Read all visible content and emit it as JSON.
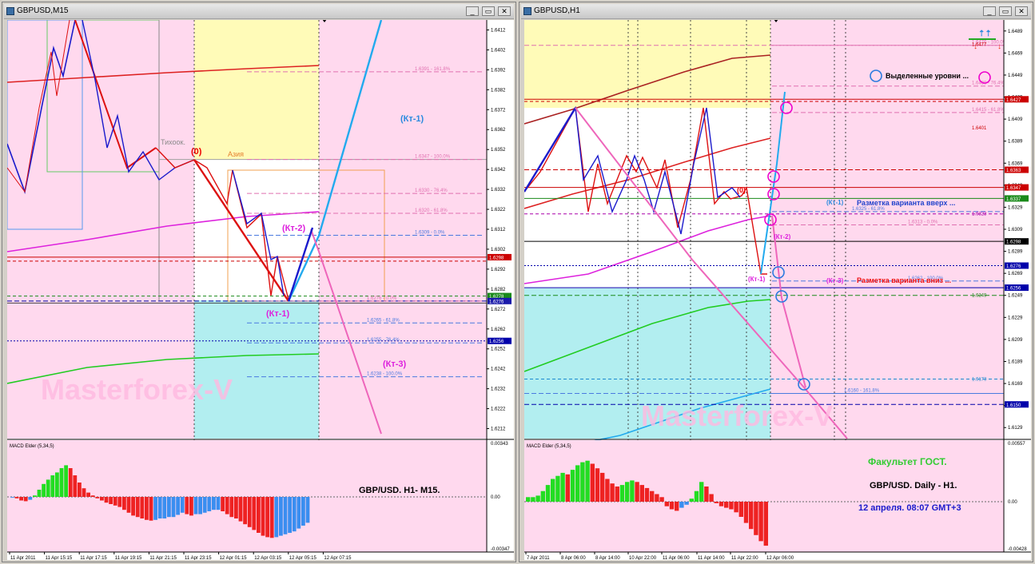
{
  "left": {
    "title": "GBPUSD,M15",
    "buttons": {
      "minimize": "_",
      "restore": "▭",
      "close": "✕"
    },
    "price_ticks": [
      "1.6412",
      "1.6402",
      "1.6392",
      "1.6382",
      "1.6372",
      "1.6362",
      "1.6352",
      "1.6342",
      "1.6332",
      "1.6322",
      "1.6312",
      "1.6302",
      "1.6292",
      "1.6282",
      "1.6272",
      "1.6262",
      "1.6252",
      "1.6242",
      "1.6232",
      "1.6222",
      "1.6212"
    ],
    "tags": [
      {
        "text": "1.6298",
        "color": "#cc0000",
        "price": 1.6298
      },
      {
        "text": "1.6278",
        "color": "#1a8a1a",
        "price": 1.62785
      },
      {
        "text": "1.6276",
        "color": "#1a1aaa",
        "price": 1.6276
      },
      {
        "text": "1.6256",
        "color": "#0000aa",
        "price": 1.6256
      }
    ],
    "fibo": [
      {
        "text": "1.6391 - 161.8%",
        "price": 1.6391,
        "color": "#e070b0"
      },
      {
        "text": "1.6347 - 100.0%",
        "price": 1.6347,
        "color": "#e070b0"
      },
      {
        "text": "1.6330 - 76.4%",
        "price": 1.633,
        "color": "#e070b0"
      },
      {
        "text": "1.6320 - 61.8%",
        "price": 1.632,
        "color": "#e070b0"
      },
      {
        "text": "1.6309 - 0.0%",
        "price": 1.6309,
        "color": "#4a7adf"
      },
      {
        "text": "1.6276 - 0.0%",
        "price": 1.6276,
        "color": "#e070b0"
      },
      {
        "text": "1.6265 - 61.8%",
        "price": 1.6265,
        "color": "#4a7adf"
      },
      {
        "text": "1.6255 - 76.4%",
        "price": 1.6255,
        "color": "#4a7adf"
      },
      {
        "text": "1.6238 - 100.0%",
        "price": 1.6238,
        "color": "#4a7adf"
      }
    ],
    "labels": {
      "tikhook": "Тихоок.",
      "asia": "Азия",
      "zero": "(0)",
      "kt1_blue": "(Кт-1)",
      "kt2": "(Кт-2)",
      "kt1": "(Кт-1)",
      "kt3": "(Кт-3)",
      "watermark": "Masterforex-V",
      "macd_title": "MACD Elder (5,34,5)",
      "macd_ticks": [
        "0.00343",
        "0.00",
        "-0.00347"
      ],
      "pair_note": "GBP/USD.  H1- M15."
    },
    "time_ticks": [
      "11 Apr 2011",
      "11 Apr 15:15",
      "11 Apr 17:15",
      "11 Apr 19:15",
      "11 Apr 21:15",
      "11 Apr 23:15",
      "12 Apr 01:15",
      "12 Apr 03:15",
      "12 Apr 05:15",
      "12 Apr 07:15"
    ]
  },
  "right": {
    "title": "GBPUSD,H1",
    "buttons": {
      "minimize": "_",
      "restore": "▭",
      "close": "✕"
    },
    "price_ticks": [
      "1.6409",
      "1.6389",
      "1.6369",
      "1.6349",
      "1.6329",
      "1.6309",
      "1.6289",
      "1.6269",
      "1.6249",
      "1.6229",
      "1.6209",
      "1.6189",
      "1.6169",
      "1.6149",
      "1.6129",
      "1.6449",
      "1.6429",
      "1.6469",
      "1.6489"
    ],
    "tags": [
      {
        "text": "1.6427",
        "color": "#cc0000",
        "price": 1.6427
      },
      {
        "text": "1.6363",
        "color": "#cc0000",
        "price": 1.6363
      },
      {
        "text": "1.6347",
        "color": "#cc0000",
        "price": 1.6347
      },
      {
        "text": "1.6337",
        "color": "#1a8a1a",
        "price": 1.6337
      },
      {
        "text": "1.6298",
        "color": "#000000",
        "price": 1.6298
      },
      {
        "text": "1.6276",
        "color": "#0000aa",
        "price": 1.6276
      },
      {
        "text": "1.6256",
        "color": "#0000aa",
        "price": 1.6256
      },
      {
        "text": "1.6150",
        "color": "#0000aa",
        "price": 1.615
      }
    ],
    "fibo": [
      {
        "text": "1.6476 - 100.0%",
        "price": 1.6476,
        "color": "#e070b0"
      },
      {
        "text": "1.6439 - 76.4%",
        "price": 1.6439,
        "color": "#e070b0"
      },
      {
        "text": "1.6415 - 61.8%",
        "price": 1.6415,
        "color": "#e070b0"
      },
      {
        "text": "1.6325 - 61.8%",
        "price": 1.6325,
        "color": "#4a7adf"
      },
      {
        "text": "1.6313 - 0.0%",
        "price": 1.6313,
        "color": "#e070b0"
      },
      {
        "text": "1.6262 - 100.0%",
        "price": 1.6262,
        "color": "#4a7adf"
      },
      {
        "text": "1.6160 - 161.8%",
        "price": 1.616,
        "color": "#4a7adf"
      }
    ],
    "minor_labels": [
      {
        "text": "1.6477",
        "price": 1.6477,
        "color": "#cc0000"
      },
      {
        "text": "1.6401",
        "price": 1.6401,
        "color": "#cc0000"
      },
      {
        "text": "1.6323",
        "price": 1.6323,
        "color": "#aa00aa"
      },
      {
        "text": "1.6249",
        "price": 1.6249,
        "color": "#1a8a1a"
      },
      {
        "text": "1.6173",
        "price": 1.6173,
        "color": "#1a8ad0"
      }
    ],
    "labels": {
      "zero": "(0)",
      "kt1_blue": "(Кт-1)",
      "kt2": "(Кт-2)",
      "kt1": "(Кт-1)",
      "kt3": "(Кт-3)",
      "legend_levels": "Выделенные уровни ...",
      "up_variant": "Разметка варианта вверх ...",
      "down_variant": "Разметка варианта вниз ...",
      "watermark": "Masterforex-V",
      "macd_title": "MACD Elder (5,34,5)",
      "macd_ticks": [
        "0.00557",
        "0.00",
        "-0.00428"
      ],
      "faculty": "Факультет ГОСТ.",
      "pair_note": "GBP/USD. Daily - H1.",
      "date_note": "12 апреля. 08:07 GMT+3"
    },
    "time_ticks": [
      "7 Apr 2011",
      "8 Apr 06:00",
      "8 Apr 14:00",
      "10 Apr 22:00",
      "11 Apr 06:00",
      "11 Apr 14:00",
      "11 Apr 22:00",
      "12 Apr 06:00"
    ]
  },
  "colors": {
    "pink": "#ffd9ee",
    "yellow": "#fffbb8",
    "cyan": "#b2eef0",
    "white": "#ffffff",
    "bull": "#22dd22",
    "bear": "#ee2222",
    "blue_bar": "#3a8ef0"
  }
}
